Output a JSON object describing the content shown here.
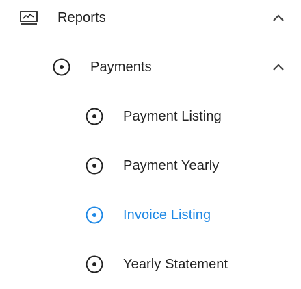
{
  "colors": {
    "text": "#222222",
    "active": "#1e88e5"
  },
  "menu": {
    "reports": {
      "label": "Reports",
      "icon": "chart-icon",
      "expanded": true
    },
    "payments": {
      "label": "Payments",
      "icon": "radio-dot-icon",
      "expanded": true
    },
    "items": [
      {
        "label": "Payment Listing",
        "icon": "radio-dot-icon",
        "active": false
      },
      {
        "label": "Payment Yearly",
        "icon": "radio-dot-icon",
        "active": false
      },
      {
        "label": "Invoice Listing",
        "icon": "radio-dot-icon",
        "active": true
      },
      {
        "label": "Yearly Statement",
        "icon": "radio-dot-icon",
        "active": false
      }
    ]
  }
}
